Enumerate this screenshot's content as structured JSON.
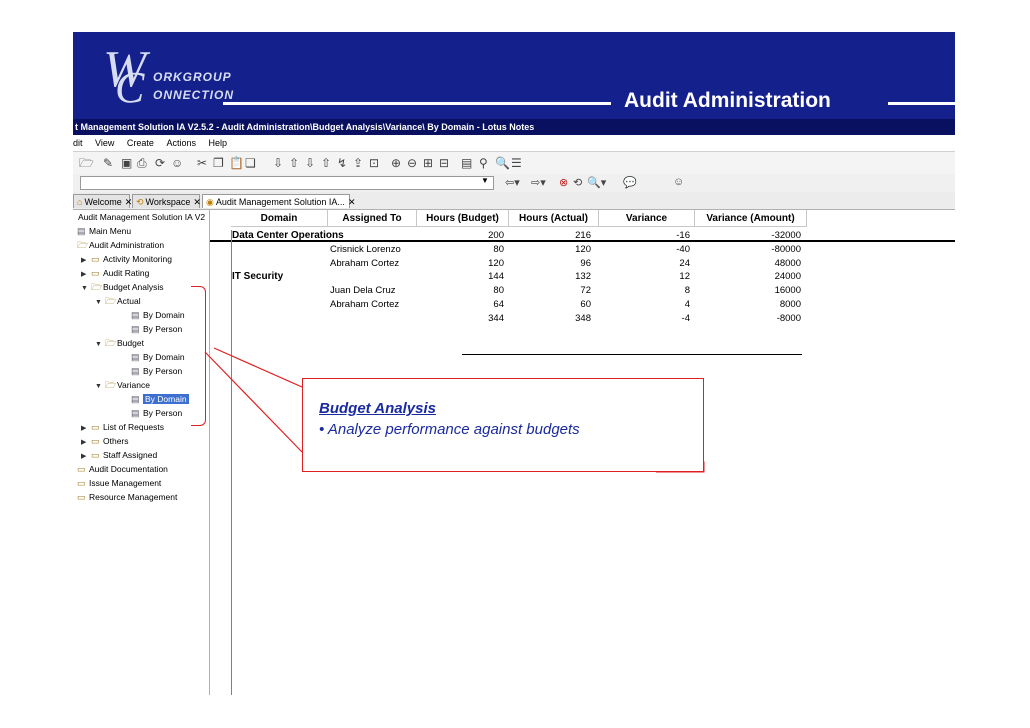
{
  "banner": {
    "logo_w": "W",
    "logo_c": "C",
    "logo_line1": "ORKGROUP",
    "logo_line2": "ONNECTION",
    "title": "Audit Administration"
  },
  "window": {
    "title": "t Management Solution IA V2.5.2 - Audit Administration\\Budget Analysis\\Variance\\ By Domain - Lotus Notes",
    "menu": [
      "dit",
      "View",
      "Create",
      "Actions",
      "Help"
    ]
  },
  "tabs": [
    {
      "label": "Welcome",
      "active": false
    },
    {
      "label": "Workspace",
      "active": false
    },
    {
      "label": "Audit Management Solution IA...",
      "active": true
    }
  ],
  "navigator": {
    "header": "Audit Management Solution IA V2",
    "items": [
      {
        "label": "Main Menu",
        "level": 0,
        "twisty": "",
        "icon": "view-icon"
      },
      {
        "label": "Audit Administration",
        "level": 0,
        "twisty": "",
        "icon": "folder-open-icon"
      },
      {
        "label": "Activity Monitoring",
        "level": 1,
        "twisty": "▶",
        "icon": "folder-icon"
      },
      {
        "label": "Audit Rating",
        "level": 1,
        "twisty": "▶",
        "icon": "folder-icon"
      },
      {
        "label": "Budget Analysis",
        "level": 1,
        "twisty": "▼",
        "icon": "folder-open-icon"
      },
      {
        "label": "Actual",
        "level": 2,
        "twisty": "▼",
        "icon": "folder-open-icon"
      },
      {
        "label": "By Domain",
        "level": 3,
        "twisty": "",
        "icon": "view-icon"
      },
      {
        "label": "By Person",
        "level": 3,
        "twisty": "",
        "icon": "view-icon"
      },
      {
        "label": "Budget",
        "level": 2,
        "twisty": "▼",
        "icon": "folder-open-icon"
      },
      {
        "label": "By Domain",
        "level": 3,
        "twisty": "",
        "icon": "view-icon"
      },
      {
        "label": "By Person",
        "level": 3,
        "twisty": "",
        "icon": "view-icon"
      },
      {
        "label": "Variance",
        "level": 2,
        "twisty": "▼",
        "icon": "folder-open-icon"
      },
      {
        "label": "By Domain",
        "level": 3,
        "twisty": "",
        "icon": "view-icon",
        "selected": true
      },
      {
        "label": "By Person",
        "level": 3,
        "twisty": "",
        "icon": "view-icon"
      },
      {
        "label": "List of Requests",
        "level": 1,
        "twisty": "▶",
        "icon": "folder-icon"
      },
      {
        "label": "Others",
        "level": 1,
        "twisty": "▶",
        "icon": "folder-icon"
      },
      {
        "label": "Staff Assigned",
        "level": 1,
        "twisty": "▶",
        "icon": "folder-icon"
      },
      {
        "label": "Audit Documentation",
        "level": 0,
        "twisty": "",
        "icon": "folder-icon"
      },
      {
        "label": "Issue Management",
        "level": 0,
        "twisty": "",
        "icon": "folder-icon"
      },
      {
        "label": "Resource Management",
        "level": 0,
        "twisty": "",
        "icon": "folder-icon"
      }
    ]
  },
  "view": {
    "columns": [
      "Domain",
      "Assigned To",
      "Hours (Budget)",
      "Hours (Actual)",
      "Variance",
      "Variance (Amount)"
    ],
    "rows": [
      {
        "domain": "Data Center Operations",
        "assigned": "",
        "budget": "200",
        "actual": "216",
        "variance": "-16",
        "amount": "-32000",
        "category": true
      },
      {
        "domain": "",
        "assigned": "Crisnick Lorenzo",
        "budget": "80",
        "actual": "120",
        "variance": "-40",
        "amount": "-80000"
      },
      {
        "domain": "",
        "assigned": "Abraham Cortez",
        "budget": "120",
        "actual": "96",
        "variance": "24",
        "amount": "48000"
      },
      {
        "domain": "IT Security",
        "assigned": "",
        "budget": "144",
        "actual": "132",
        "variance": "12",
        "amount": "24000",
        "category": true
      },
      {
        "domain": "",
        "assigned": "Juan Dela Cruz",
        "budget": "80",
        "actual": "72",
        "variance": "8",
        "amount": "16000"
      },
      {
        "domain": "",
        "assigned": "Abraham Cortez",
        "budget": "64",
        "actual": "60",
        "variance": "4",
        "amount": "8000"
      },
      {
        "domain": "",
        "assigned": "",
        "budget": "344",
        "actual": "348",
        "variance": "-4",
        "amount": "-8000",
        "total": true
      }
    ]
  },
  "callout": {
    "title": "Budget Analysis",
    "text": "• Analyze performance against budgets"
  },
  "colors": {
    "banner": "#14208c",
    "titlebar": "#0a1060",
    "annotation": "#e02020",
    "callout_text": "#1a2aa0",
    "selection": "#3d6fd1"
  }
}
